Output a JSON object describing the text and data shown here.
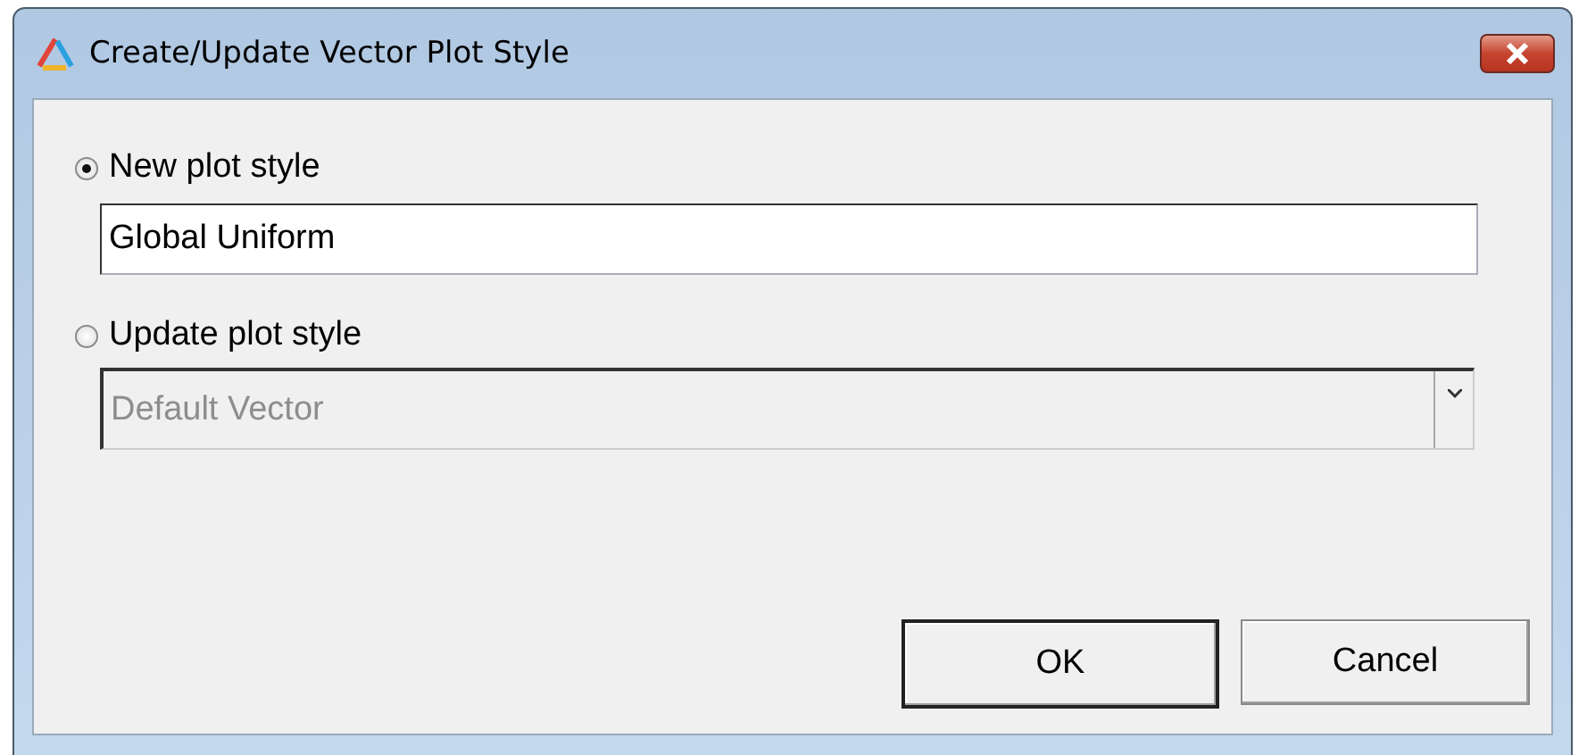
{
  "window": {
    "title": "Create/Update Vector Plot Style"
  },
  "options": [
    {
      "label": "New plot style",
      "selected": true,
      "kind": "text",
      "value": "Global Uniform",
      "disabled": false
    },
    {
      "label": "Update plot style",
      "selected": false,
      "kind": "combo",
      "value": "Default Vector",
      "disabled": true
    }
  ],
  "buttons": [
    {
      "label": "OK",
      "default": true
    },
    {
      "label": "Cancel",
      "default": false
    }
  ]
}
